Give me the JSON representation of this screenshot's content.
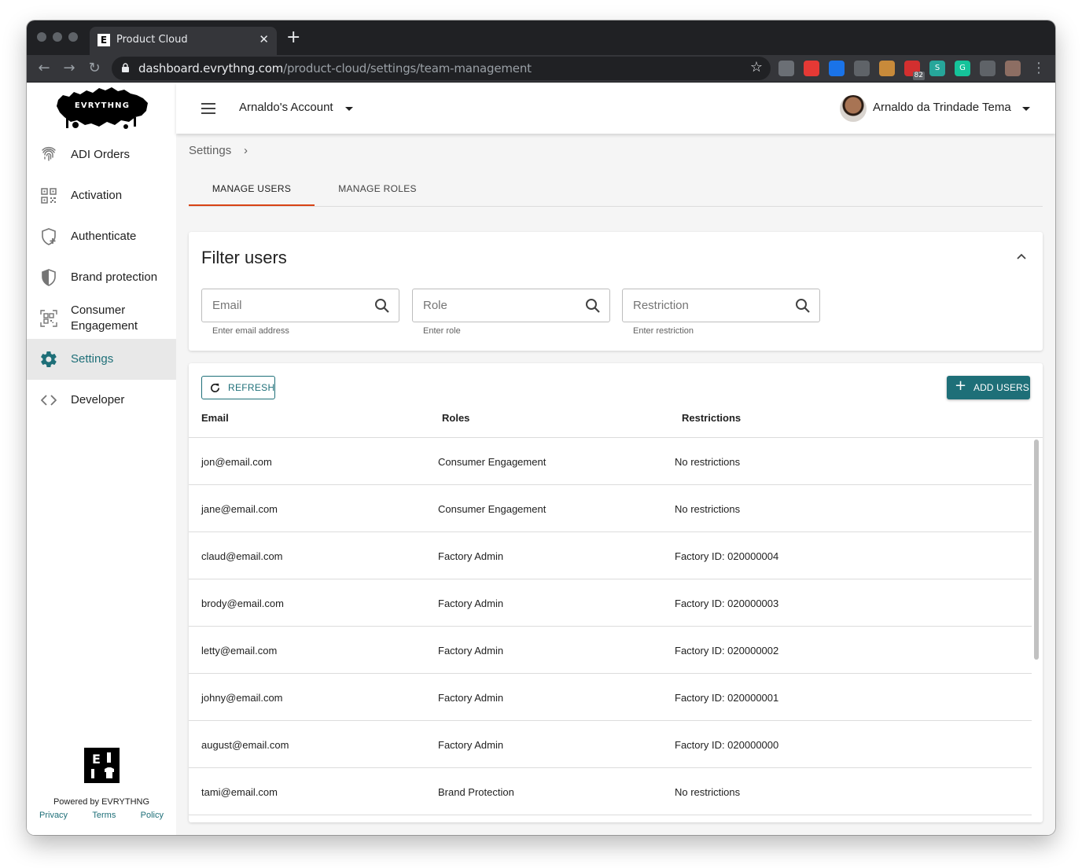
{
  "browser": {
    "tab_title": "Product Cloud",
    "tab_favicon": "E",
    "tab_close": "✕",
    "new_tab": "+",
    "url_host": "dashboard.evrythng.com",
    "url_path": "/product-cloud/settings/team-management",
    "star": "☆",
    "extensions": [
      {
        "name": "mail-extension-icon",
        "color": "#6b6f75"
      },
      {
        "name": "adblock-extension-icon",
        "color": "#e53935"
      },
      {
        "name": "bing-extension-icon",
        "color": "#1a73e8"
      },
      {
        "name": "shield-extension-icon",
        "color": "#5f6368"
      },
      {
        "name": "cookie-extension-icon",
        "color": "#c88a3a"
      },
      {
        "name": "calendar-extension-icon",
        "color": "#d32f2f",
        "badge": "82"
      },
      {
        "name": "s-extension-icon",
        "color": "#26a69a",
        "label": "S"
      },
      {
        "name": "grammarly-extension-icon",
        "color": "#15c39a",
        "label": "G"
      },
      {
        "name": "puzzle-extension-icon",
        "color": "#5f6368"
      },
      {
        "name": "profile-extension-icon",
        "color": "#8d6e63"
      }
    ]
  },
  "header": {
    "account": "Arnaldo's Account",
    "user_name": "Arnaldo da Trindade Tema"
  },
  "sidebar": {
    "logo_text": "EVRYTHNG",
    "items": [
      {
        "label": "ADI Orders",
        "icon": "fingerprint-icon"
      },
      {
        "label": "Activation",
        "icon": "qr-code-icon"
      },
      {
        "label": "Authenticate",
        "icon": "shield-plus-icon"
      },
      {
        "label": "Brand protection",
        "icon": "shield-half-icon"
      },
      {
        "label": "Consumer Engagement",
        "icon": "qr-scan-icon"
      },
      {
        "label": "Settings",
        "icon": "gear-icon",
        "active": true
      },
      {
        "label": "Developer",
        "icon": "code-icon"
      }
    ],
    "powered_logo": "E",
    "powered_by": "Powered by EVRYTHNG",
    "footer_links": [
      "Privacy",
      "Terms",
      "Policy"
    ]
  },
  "breadcrumb": {
    "label": "Settings",
    "chevron": "›"
  },
  "tabs": [
    {
      "label": "MANAGE USERS",
      "active": true
    },
    {
      "label": "MANAGE ROLES",
      "active": false
    }
  ],
  "filter": {
    "title": "Filter users",
    "fields": [
      {
        "placeholder": "Email",
        "helper": "Enter email address"
      },
      {
        "placeholder": "Role",
        "helper": "Enter role"
      },
      {
        "placeholder": "Restriction",
        "helper": "Enter restriction"
      }
    ]
  },
  "table": {
    "refresh_label": "REFRESH",
    "add_label": "ADD USERS",
    "add_plus": "+",
    "columns": [
      "Email",
      "Roles",
      "Restrictions"
    ],
    "rows": [
      {
        "email": "jon@email.com",
        "role": "Consumer Engagement",
        "restriction": "No restrictions"
      },
      {
        "email": "jane@email.com",
        "role": "Consumer Engagement",
        "restriction": "No restrictions"
      },
      {
        "email": "claud@email.com",
        "role": "Factory Admin",
        "restriction": "Factory ID: 020000004"
      },
      {
        "email": "brody@email.com",
        "role": "Factory Admin",
        "restriction": "Factory ID: 020000003"
      },
      {
        "email": "letty@email.com",
        "role": "Factory Admin",
        "restriction": "Factory ID: 020000002"
      },
      {
        "email": "johny@email.com",
        "role": "Factory Admin",
        "restriction": "Factory ID: 020000001"
      },
      {
        "email": "august@email.com",
        "role": "Factory Admin",
        "restriction": "Factory ID: 020000000"
      },
      {
        "email": "tami@email.com",
        "role": "Brand Protection",
        "restriction": "No restrictions"
      }
    ]
  },
  "colors": {
    "accent": "#1e6f78",
    "tab_indicator": "#d84315"
  }
}
